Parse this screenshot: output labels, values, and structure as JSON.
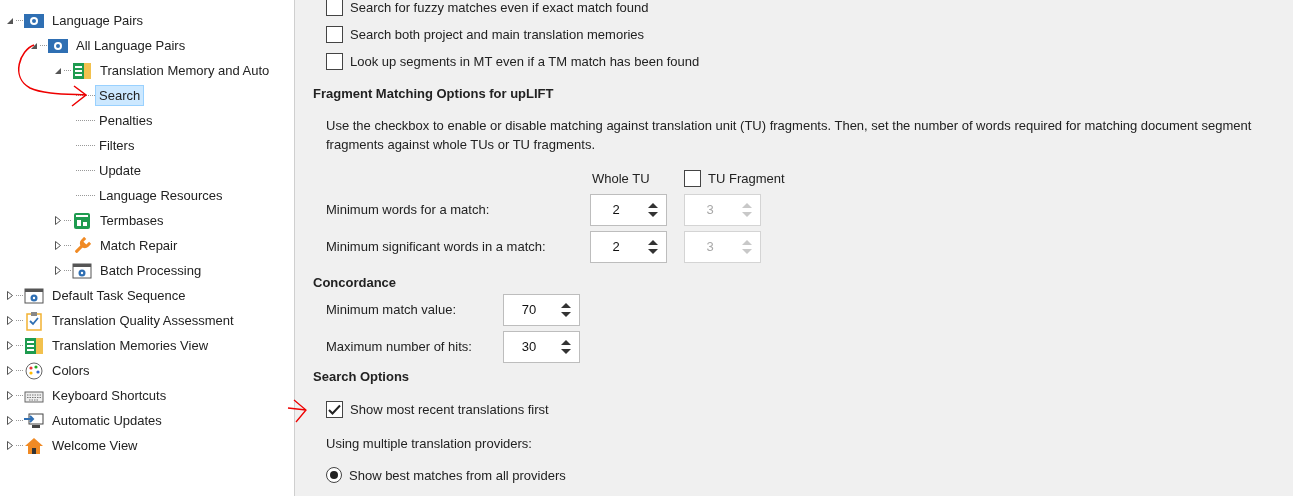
{
  "tree": [
    {
      "label": "Language Pairs",
      "kind": "language",
      "expanded": true,
      "selected": false,
      "children": [
        {
          "label": "All Language Pairs",
          "kind": "language",
          "expanded": true,
          "selected": false,
          "children": [
            {
              "label": "Translation Memory and Auto",
              "kind": "memory",
              "expanded": true,
              "selected": false,
              "children": [
                {
                  "label": "Search",
                  "kind": "leaf",
                  "selected": true
                },
                {
                  "label": "Penalties",
                  "kind": "leaf",
                  "selected": false
                },
                {
                  "label": "Filters",
                  "kind": "leaf",
                  "selected": false
                },
                {
                  "label": "Update",
                  "kind": "leaf",
                  "selected": false
                },
                {
                  "label": "Language Resources",
                  "kind": "leaf",
                  "selected": false
                }
              ]
            },
            {
              "label": "Termbases",
              "kind": "termbase",
              "expanded": false,
              "selected": false
            },
            {
              "label": "Match Repair",
              "kind": "wrench",
              "expanded": false,
              "selected": false
            },
            {
              "label": "Batch Processing",
              "kind": "gear",
              "expanded": false,
              "selected": false
            }
          ]
        }
      ]
    },
    {
      "label": "Default Task Sequence",
      "kind": "gear",
      "expanded": false,
      "selected": false
    },
    {
      "label": "Translation Quality Assessment",
      "kind": "clipboard",
      "expanded": false,
      "selected": false
    },
    {
      "label": "Translation Memories View",
      "kind": "memory",
      "expanded": false,
      "selected": false
    },
    {
      "label": "Colors",
      "kind": "palette",
      "expanded": false,
      "selected": false
    },
    {
      "label": "Keyboard Shortcuts",
      "kind": "keyboard",
      "expanded": false,
      "selected": false
    },
    {
      "label": "Automatic Updates",
      "kind": "computer",
      "expanded": false,
      "selected": false
    },
    {
      "label": "Welcome View",
      "kind": "house",
      "expanded": false,
      "selected": false
    }
  ],
  "search_checkboxes": [
    {
      "label": "Search for fuzzy matches even if exact match found",
      "checked": false
    },
    {
      "label": "Search both project and main translation memories",
      "checked": false
    },
    {
      "label": "Look up segments in MT even if a TM match has been found",
      "checked": false
    }
  ],
  "fragment": {
    "heading": "Fragment Matching Options for upLIFT",
    "description": "Use the checkbox to enable or disable matching against translation unit (TU)  fragments. Then, set the number of words required for matching document segment fragments against whole TUs or TU fragments.",
    "whole_tu_header": "Whole TU",
    "tu_fragment": {
      "label": "TU Fragment",
      "checked": false
    },
    "rows": [
      {
        "label": "Minimum words for a match:",
        "whole_tu": {
          "value": "2",
          "disabled": false
        },
        "tu_fragment": {
          "value": "3",
          "disabled": true
        }
      },
      {
        "label": "Minimum significant words in a match:",
        "whole_tu": {
          "value": "2",
          "disabled": false
        },
        "tu_fragment": {
          "value": "3",
          "disabled": true
        }
      }
    ]
  },
  "concordance": {
    "heading": "Concordance",
    "rows": [
      {
        "label": "Minimum match value:",
        "value": "70",
        "disabled": false
      },
      {
        "label": "Maximum number of hits:",
        "value": "30",
        "disabled": false
      }
    ]
  },
  "search_options": {
    "heading": "Search Options",
    "recent_first": {
      "label": "Show most recent translations first",
      "checked": true
    },
    "providers_label": "Using multiple translation providers:",
    "radios": [
      {
        "label": "Show best matches from all providers",
        "selected": true
      }
    ]
  }
}
